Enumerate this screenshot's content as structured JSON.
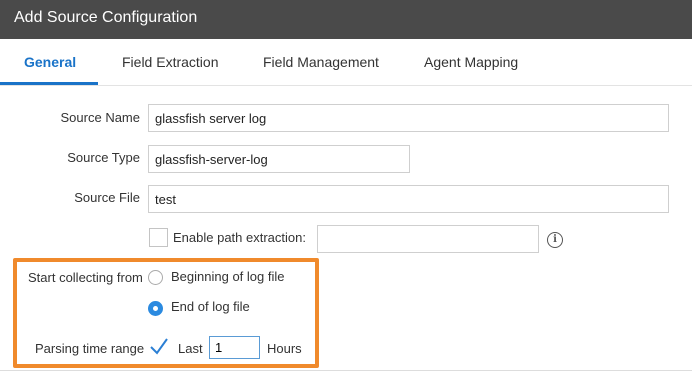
{
  "window": {
    "title": "Add Source Configuration"
  },
  "tabs": [
    {
      "label": "General",
      "active": true
    },
    {
      "label": "Field Extraction",
      "active": false
    },
    {
      "label": "Field Management",
      "active": false
    },
    {
      "label": "Agent Mapping",
      "active": false
    }
  ],
  "form": {
    "source_name": {
      "label": "Source Name",
      "value": "glassfish server log"
    },
    "source_type": {
      "label": "Source Type",
      "value": "glassfish-server-log"
    },
    "source_file": {
      "label": "Source File",
      "value": "test"
    },
    "path_extraction": {
      "label": "Enable path extraction:",
      "checked": false,
      "value": "",
      "info_icon": "info-icon"
    },
    "start_collecting": {
      "label": "Start collecting from",
      "options": [
        {
          "label": "Beginning of log file",
          "selected": false
        },
        {
          "label": "End of log file",
          "selected": true
        }
      ]
    },
    "parsing_time_range": {
      "label": "Parsing time range",
      "checked": true,
      "prefix": "Last",
      "value": "1",
      "unit": "Hours"
    }
  },
  "colors": {
    "accent": "#1a73c8",
    "highlight": "#f08a2c",
    "titlebar": "#4a4a4a"
  }
}
